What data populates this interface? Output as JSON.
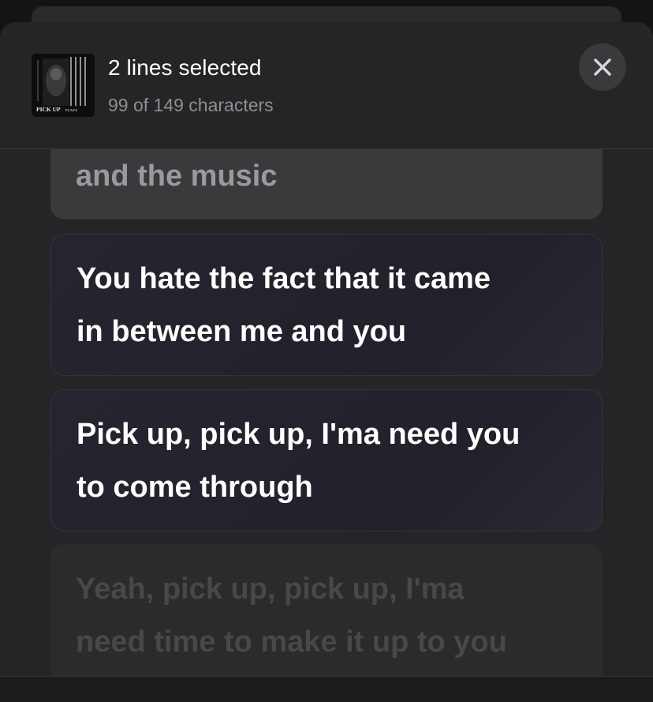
{
  "header": {
    "title": "2 lines selected",
    "subtitle": "99 of 149 characters",
    "artwork_text": "PICK UP",
    "artwork_text_small": "FLAZA"
  },
  "close_icon": "close-icon",
  "lyrics": {
    "previous": {
      "line2": "and the music"
    },
    "selected": [
      {
        "line1": "You hate the fact that it came",
        "line2": "in between me and you"
      },
      {
        "line1": "Pick up, pick up, I'ma need you",
        "line2": "to come through"
      }
    ],
    "next": {
      "line1": "Yeah, pick up, pick up, I'ma",
      "line2": "need time to make it up to you"
    }
  },
  "colors": {
    "background": "#141416",
    "sheet": "#252527",
    "selected_card": "#26252f",
    "unselected_card": "#3a3a3c"
  }
}
